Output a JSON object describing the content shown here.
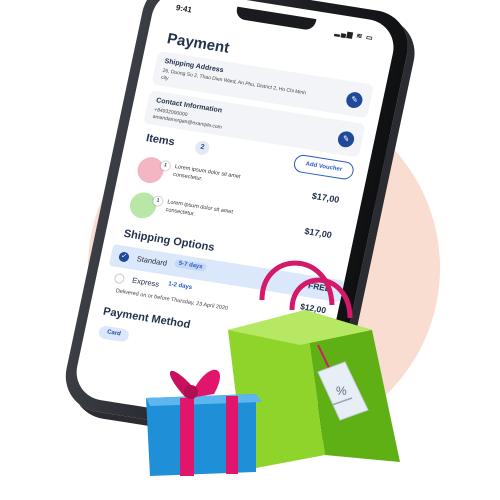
{
  "status": {
    "time": "9:41",
    "icons_text": "▂▄▆ ≋ ▭"
  },
  "page": {
    "title": "Payment"
  },
  "shipping_address": {
    "title": "Shipping Address",
    "text": "26, Duong So 2, Thao Dien Ward, An Phu, District 2, Ho Chi Minh city",
    "edit_glyph": "✎"
  },
  "contact": {
    "title": "Contact Information",
    "phone": "+84932000000",
    "email": "amandamorgan@example.com",
    "edit_glyph": "✎"
  },
  "items": {
    "heading": "Items",
    "count": "2",
    "voucher_label": "Add Voucher",
    "list": [
      {
        "qty": "1",
        "description": "Lorem ipsum dolor sit amet consectetur.",
        "price": "$17,00",
        "thumb_color": "#f4b6c2"
      },
      {
        "qty": "1",
        "description": "Lorem ipsum dolor sit amet consectetur.",
        "price": "$17,00",
        "thumb_color": "#b9e7a8"
      }
    ]
  },
  "shipping": {
    "heading": "Shipping Options",
    "options": [
      {
        "label": "Standard",
        "days": "5-7 days",
        "price": "FREE",
        "selected": true,
        "check": "✓"
      },
      {
        "label": "Express",
        "days": "1-2 days",
        "price": "$12,00",
        "selected": false
      }
    ],
    "delivery_note": "Delivered on or before Thursday, 23 April 2020"
  },
  "payment": {
    "heading": "Payment Method",
    "method_chip": "Card"
  },
  "colors": {
    "accent": "#1f4a99",
    "bag_green": "#7ccc1c",
    "gift_blue": "#1f8fd8",
    "ribbon": "#e0156b",
    "bg_circle": "#f8ddd0"
  },
  "illustration": {
    "tag_glyph": "%"
  }
}
